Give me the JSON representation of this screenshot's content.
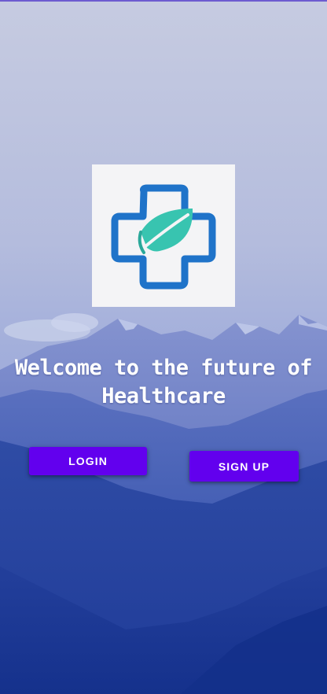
{
  "colors": {
    "primary_button": "#6200ee",
    "top_line": "#6d5bd0",
    "logo_blue": "#1f73c9",
    "logo_teal": "#38c4b0",
    "sky_top": "#c4cae2",
    "mountain_deep": "#1d3a95"
  },
  "welcome": {
    "title": "Welcome to the future of Healthcare"
  },
  "buttons": {
    "login_label": "LOGIN",
    "signup_label": "SIGN UP"
  },
  "icons": {
    "logo": "medical-cross-leaf-icon"
  }
}
